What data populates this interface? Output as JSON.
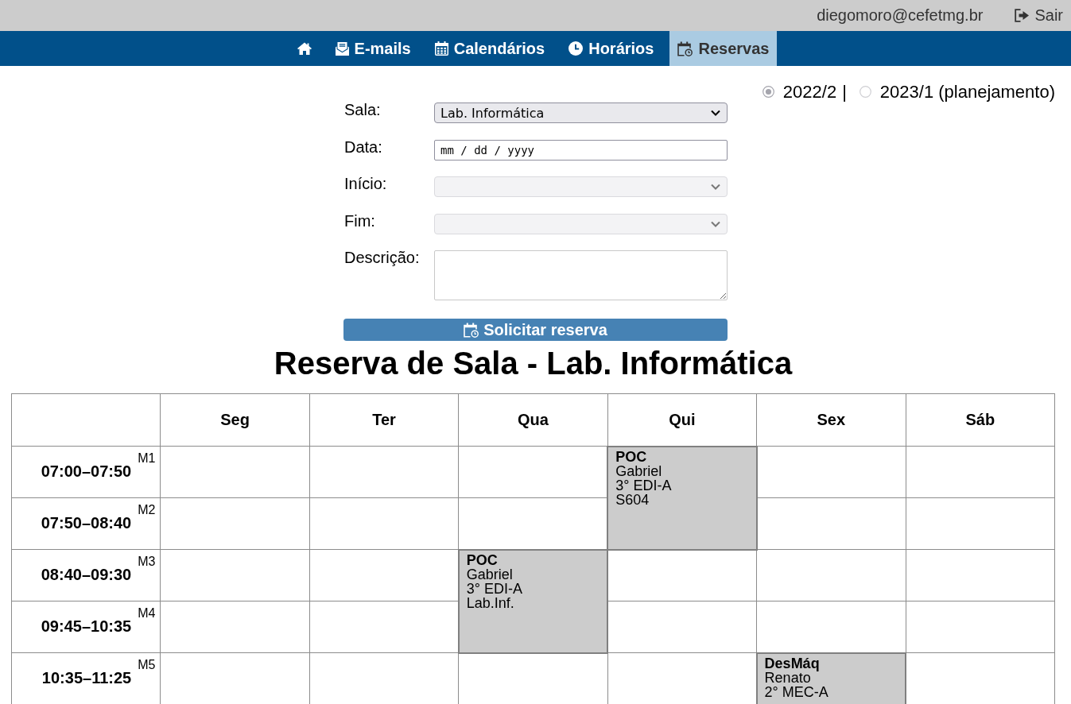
{
  "top_bar": {
    "user_email": "diegomoro@cefetmg.br",
    "logout": "Sair"
  },
  "nav": [
    {
      "kind": "home",
      "selected": false
    },
    {
      "kind": "mail",
      "label": "E-mails",
      "selected": false
    },
    {
      "kind": "calendar",
      "label": "Calendários",
      "selected": false
    },
    {
      "kind": "clock",
      "label": "Horários",
      "selected": false
    },
    {
      "kind": "reservation",
      "label": "Reservas",
      "selected": true
    }
  ],
  "semester_picker": {
    "options": [
      {
        "label": "2022/2",
        "selected": true
      },
      {
        "label": "2023/1 (planejamento)",
        "selected": false
      }
    ],
    "separator": "|"
  },
  "form": {
    "fields": [
      {
        "label": "Sala:",
        "kind": "select",
        "value": "Lab. Informática",
        "disabled": false
      },
      {
        "label": "Data:",
        "kind": "date",
        "placeholder": "mm / dd / yyyy",
        "disabled": false
      },
      {
        "label": "Início:",
        "kind": "select",
        "disabled": true
      },
      {
        "label": "Fim:",
        "kind": "select",
        "disabled": true
      },
      {
        "label": "Descrição:",
        "kind": "textarea",
        "disabled": false
      }
    ],
    "submit": "Solicitar reserva"
  },
  "title": "Reserva de Sala - Lab. Informática",
  "schedule": {
    "days": [
      "Seg",
      "Ter",
      "Qua",
      "Qui",
      "Sex",
      "Sáb"
    ],
    "rows": [
      {
        "time": "07:00–07:50",
        "period": "M1",
        "cells": [
          {
            "kind": "empty"
          },
          {
            "kind": "empty"
          },
          {
            "kind": "empty"
          },
          {
            "kind": "booking",
            "subject": "POC",
            "teacher": "Gabriel",
            "group": "3° EDI-A",
            "room": "S604"
          },
          {
            "kind": "empty"
          },
          {
            "kind": "empty"
          }
        ]
      },
      {
        "time": "07:50–08:40",
        "period": "M2",
        "cells": [
          {
            "kind": "empty"
          },
          {
            "kind": "empty"
          },
          {
            "kind": "empty"
          },
          {
            "kind": "covered"
          },
          {
            "kind": "empty"
          },
          {
            "kind": "empty"
          }
        ]
      },
      {
        "time": "08:40–09:30",
        "period": "M3",
        "cells": [
          {
            "kind": "empty"
          },
          {
            "kind": "empty"
          },
          {
            "kind": "booking",
            "subject": "POC",
            "teacher": "Gabriel",
            "group": "3° EDI-A",
            "room": "Lab.Inf."
          },
          {
            "kind": "empty"
          },
          {
            "kind": "empty"
          },
          {
            "kind": "empty"
          }
        ]
      },
      {
        "time": "09:45–10:35",
        "period": "M4",
        "cells": [
          {
            "kind": "empty"
          },
          {
            "kind": "empty"
          },
          {
            "kind": "covered"
          },
          {
            "kind": "empty"
          },
          {
            "kind": "empty"
          },
          {
            "kind": "empty"
          }
        ]
      },
      {
        "time": "10:35–11:25",
        "period": "M5",
        "cells": [
          {
            "kind": "empty"
          },
          {
            "kind": "empty"
          },
          {
            "kind": "empty"
          },
          {
            "kind": "empty"
          },
          {
            "kind": "booking",
            "subject": "DesMáq",
            "teacher": "Renato",
            "group": "2° MEC-A"
          },
          {
            "kind": "empty"
          }
        ]
      }
    ]
  }
}
